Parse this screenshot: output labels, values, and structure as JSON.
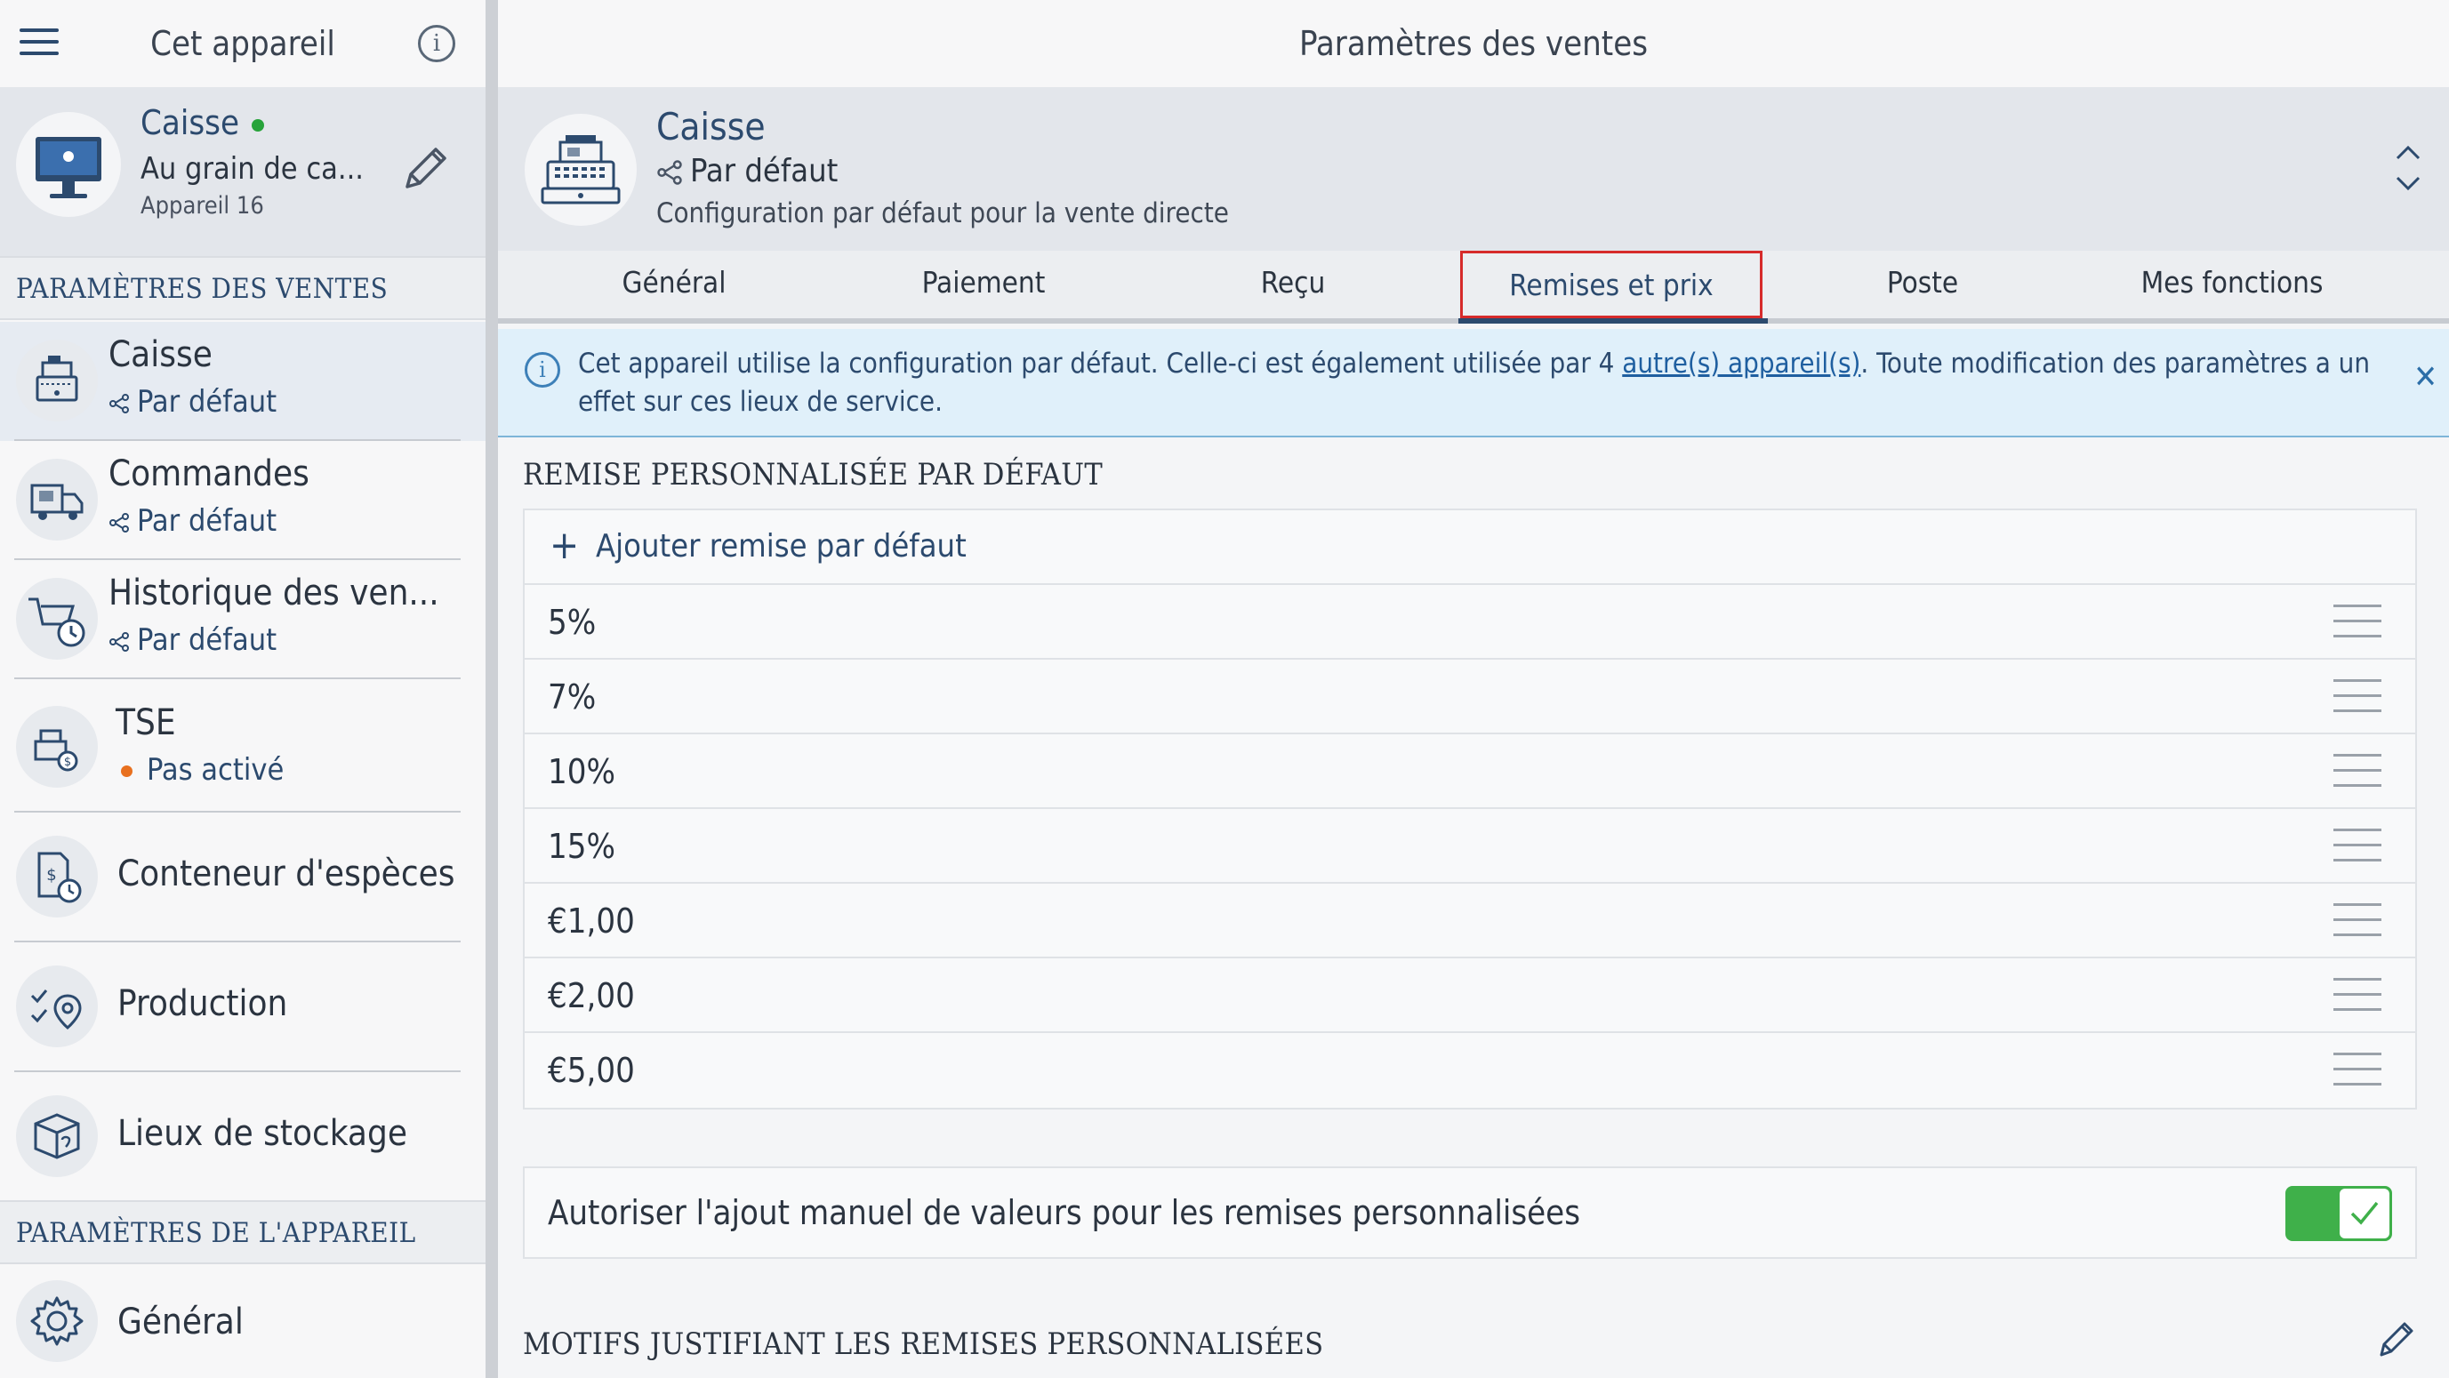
{
  "sidebar": {
    "title": "Cet appareil",
    "device": {
      "name": "Caisse",
      "location": "Au grain de ca...",
      "id_label": "Appareil 16"
    },
    "sections": [
      {
        "header": "PARAMÈTRES DES VENTES",
        "items": [
          {
            "label": "Caisse",
            "sub": "Par défaut",
            "icon": "cash-register-icon",
            "active": true
          },
          {
            "label": "Commandes",
            "sub": "Par défaut",
            "icon": "delivery-truck-icon"
          },
          {
            "label": "Historique des ven...",
            "sub": "Par défaut",
            "icon": "cart-history-icon"
          },
          {
            "label": "TSE",
            "sub": "Pas activé",
            "icon": "tse-icon",
            "status_color": "#e8701f"
          },
          {
            "label": "Conteneur d'espèces",
            "icon": "cash-container-icon"
          },
          {
            "label": "Production",
            "icon": "production-icon"
          },
          {
            "label": "Lieux de stockage",
            "icon": "storage-icon"
          }
        ]
      },
      {
        "header": "PARAMÈTRES DE L'APPAREIL",
        "items": [
          {
            "label": "Général",
            "icon": "gear-icon"
          }
        ]
      }
    ]
  },
  "main": {
    "title": "Paramètres des ventes",
    "config": {
      "name": "Caisse",
      "mode": "Par défaut",
      "description": "Configuration par défaut pour la vente directe"
    },
    "tabs": [
      "Général",
      "Paiement",
      "Reçu",
      "Remises et prix",
      "Poste",
      "Mes fonctions"
    ],
    "active_tab": "Remises et prix",
    "banner": {
      "text_before": "Cet appareil utilise la configuration par défaut. Celle-ci est également utilisée par 4 ",
      "link": "autre(s) appareil(s)",
      "text_after": ". Toute modification des paramètres a un effet sur ces lieux de service."
    },
    "discount_section": {
      "header": "REMISE PERSONNALISÉE PAR DÉFAUT",
      "add_label": "Ajouter remise par défaut",
      "values": [
        "5%",
        "7%",
        "10%",
        "15%",
        "€1,00",
        "€2,00",
        "€5,00"
      ]
    },
    "manual_toggle": {
      "label": "Autoriser l'ajout manuel de valeurs pour les remises personnalisées",
      "enabled": true
    },
    "reasons_section": {
      "header": "MOTIFS JUSTIFIANT LES REMISES PERSONNALISÉES"
    }
  },
  "colors": {
    "accent": "#2c4a6e",
    "toggle_on": "#3fb04a",
    "status_green": "#27a33a",
    "status_orange": "#e8701f",
    "highlight": "#d62b2b"
  }
}
